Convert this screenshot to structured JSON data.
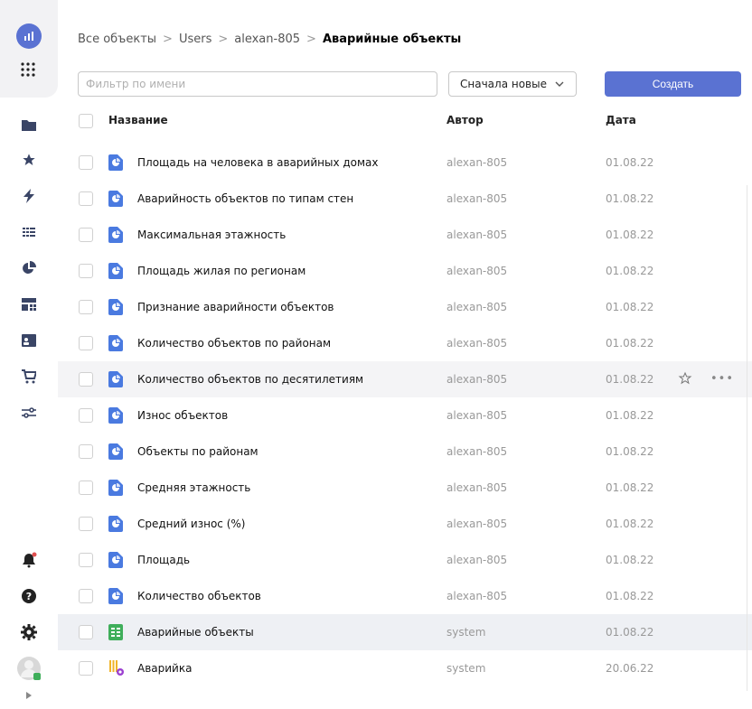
{
  "breadcrumb": {
    "items": [
      "Все объекты",
      "Users",
      "alexan-805"
    ],
    "current": "Аварийные объекты",
    "separator": ">"
  },
  "toolbar": {
    "filter_placeholder": "Фильтр по имени",
    "sort_value": "Сначала новые",
    "create_label": "Создать"
  },
  "table": {
    "headers": {
      "name": "Название",
      "author": "Автор",
      "date": "Дата"
    },
    "rows": [
      {
        "name": "Площадь на человека в аварийных домах",
        "author": "alexan-805",
        "date": "01.08.22",
        "icon": "chart-icon"
      },
      {
        "name": "Аварийность объектов по типам стен",
        "author": "alexan-805",
        "date": "01.08.22",
        "icon": "chart-icon"
      },
      {
        "name": "Максимальная этажность",
        "author": "alexan-805",
        "date": "01.08.22",
        "icon": "chart-icon"
      },
      {
        "name": "Площадь жилая по регионам",
        "author": "alexan-805",
        "date": "01.08.22",
        "icon": "chart-icon"
      },
      {
        "name": "Признание аварийности объектов",
        "author": "alexan-805",
        "date": "01.08.22",
        "icon": "chart-icon"
      },
      {
        "name": "Количество объектов по районам",
        "author": "alexan-805",
        "date": "01.08.22",
        "icon": "chart-icon"
      },
      {
        "name": "Количество объектов по десятилетиям",
        "author": "alexan-805",
        "date": "01.08.22",
        "icon": "chart-icon"
      },
      {
        "name": "Износ объектов",
        "author": "alexan-805",
        "date": "01.08.22",
        "icon": "chart-icon"
      },
      {
        "name": "Объекты по районам",
        "author": "alexan-805",
        "date": "01.08.22",
        "icon": "chart-icon"
      },
      {
        "name": "Средняя этажность",
        "author": "alexan-805",
        "date": "01.08.22",
        "icon": "chart-icon"
      },
      {
        "name": "Средний износ (%)",
        "author": "alexan-805",
        "date": "01.08.22",
        "icon": "chart-icon"
      },
      {
        "name": "Площадь",
        "author": "alexan-805",
        "date": "01.08.22",
        "icon": "chart-icon"
      },
      {
        "name": "Количество объектов",
        "author": "alexan-805",
        "date": "01.08.22",
        "icon": "chart-icon"
      },
      {
        "name": "Аварийные объекты",
        "author": "system",
        "date": "01.08.22",
        "icon": "dataset-icon"
      },
      {
        "name": "Аварийка",
        "author": "system",
        "date": "20.06.22",
        "icon": "connection-icon"
      }
    ],
    "hover_row_index": 6,
    "selected_row_index": 13,
    "hover_actions": {
      "star_icon": "star-outline-icon",
      "more_label": "•••"
    }
  },
  "sidebar": {
    "items": [
      "logo-icon",
      "apps-grid-icon",
      "folder-icon",
      "star-icon",
      "lightning-icon",
      "list-icon",
      "pie-chart-icon",
      "dashboard-icon",
      "contact-card-icon",
      "cart-icon",
      "sliders-icon",
      "bell-icon",
      "help-icon",
      "settings-icon",
      "avatar",
      "expand-icon"
    ]
  },
  "colors": {
    "accent": "#5a72d2",
    "chart_icon": "#4a7ae0",
    "dataset_icon": "#3fae5a",
    "connection_icon_bars": "#f0b429",
    "connection_icon_dot": "#9b3fd0",
    "nav_icon": "#3a4566"
  }
}
